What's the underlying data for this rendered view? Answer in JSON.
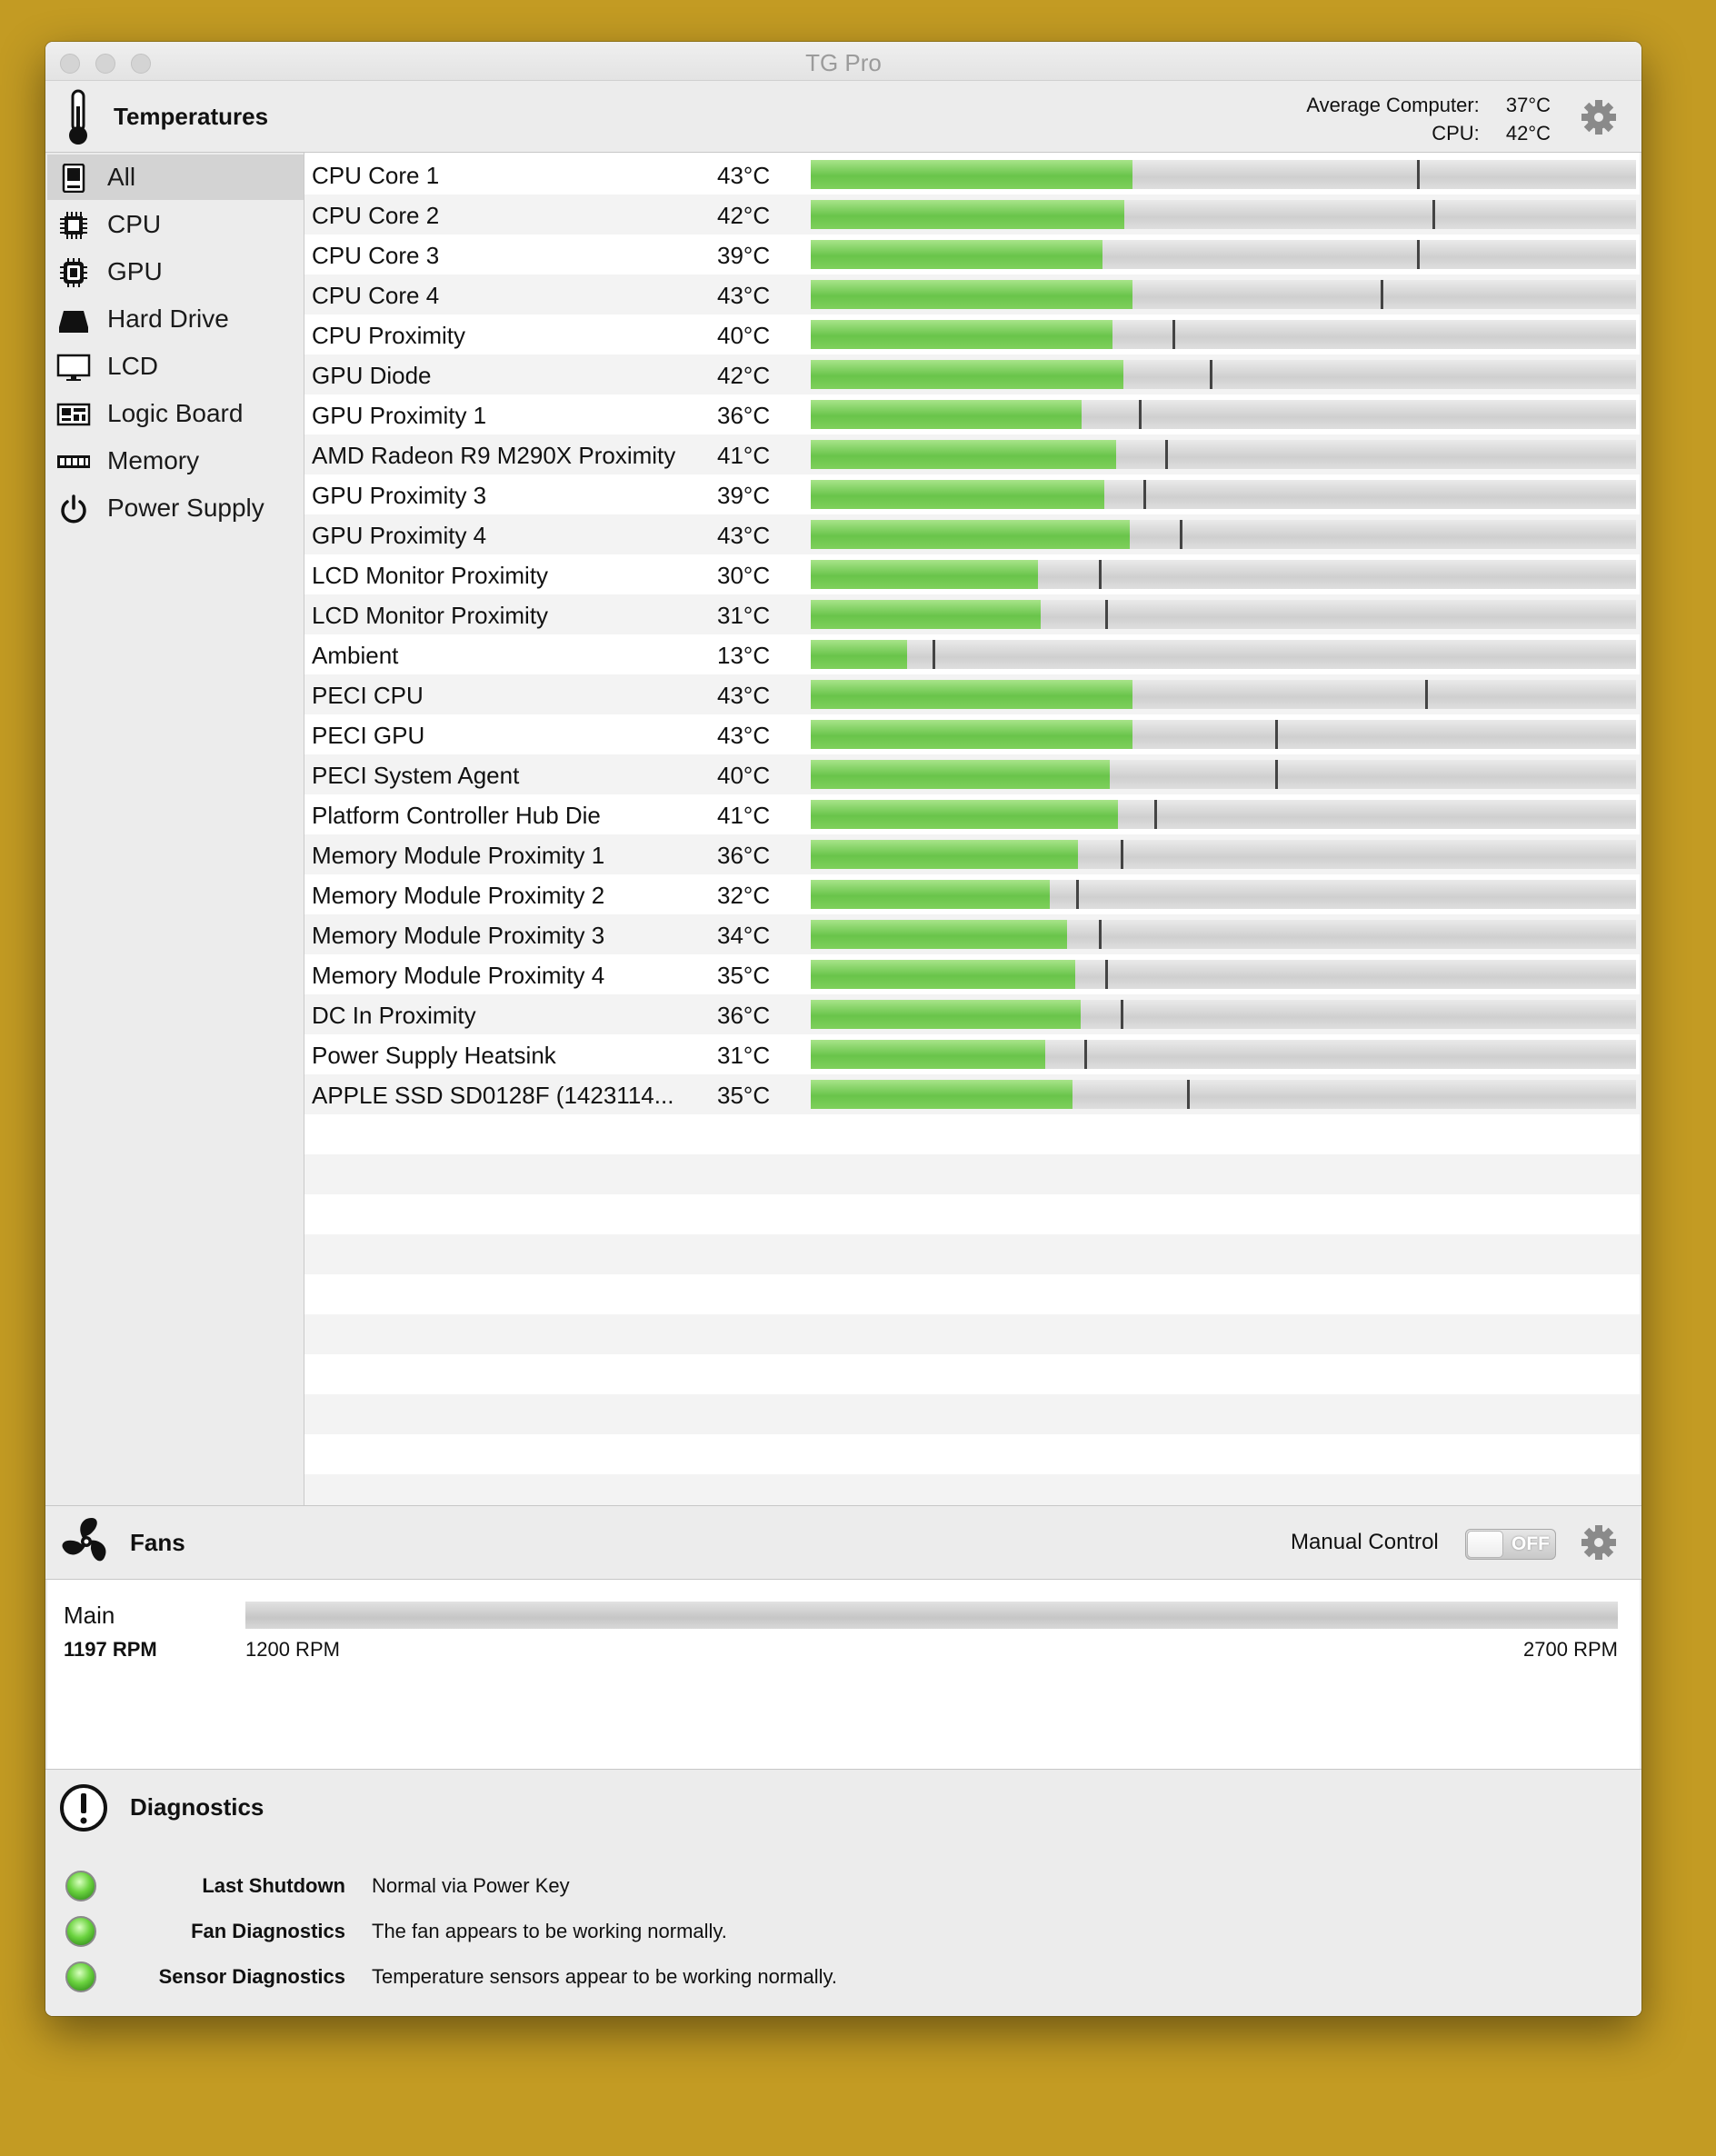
{
  "window": {
    "title": "TG Pro"
  },
  "temperatures": {
    "title": "Temperatures",
    "average_label": "Average Computer:",
    "average_value": "37°C",
    "cpu_label": "CPU:",
    "cpu_value": "42°C"
  },
  "sidebar": {
    "items": [
      {
        "label": "All",
        "icon": "computer-icon",
        "selected": true
      },
      {
        "label": "CPU",
        "icon": "cpu-chip-icon"
      },
      {
        "label": "GPU",
        "icon": "gpu-chip-icon"
      },
      {
        "label": "Hard Drive",
        "icon": "hard-drive-icon"
      },
      {
        "label": "LCD",
        "icon": "monitor-icon"
      },
      {
        "label": "Logic Board",
        "icon": "logic-board-icon"
      },
      {
        "label": "Memory",
        "icon": "memory-icon"
      },
      {
        "label": "Power Supply",
        "icon": "power-icon"
      }
    ]
  },
  "sensors": [
    {
      "name": "CPU Core 1",
      "temp": "43°C",
      "level": 0.39,
      "max": 0.735
    },
    {
      "name": "CPU Core 2",
      "temp": "42°C",
      "level": 0.38,
      "max": 0.753
    },
    {
      "name": "CPU Core 3",
      "temp": "39°C",
      "level": 0.353,
      "max": 0.735
    },
    {
      "name": "CPU Core 4",
      "temp": "43°C",
      "level": 0.39,
      "max": 0.69
    },
    {
      "name": "CPU Proximity",
      "temp": "40°C",
      "level": 0.366,
      "max": 0.438
    },
    {
      "name": "GPU Diode",
      "temp": "42°C",
      "level": 0.379,
      "max": 0.484
    },
    {
      "name": "GPU Proximity 1",
      "temp": "36°C",
      "level": 0.328,
      "max": 0.398
    },
    {
      "name": "AMD Radeon R9 M290X Proximity",
      "temp": "41°C",
      "level": 0.37,
      "max": 0.429
    },
    {
      "name": "GPU Proximity 3",
      "temp": "39°C",
      "level": 0.356,
      "max": 0.403
    },
    {
      "name": "GPU Proximity 4",
      "temp": "43°C",
      "level": 0.387,
      "max": 0.447
    },
    {
      "name": "LCD Monitor Proximity",
      "temp": "30°C",
      "level": 0.275,
      "max": 0.349
    },
    {
      "name": "LCD Monitor Proximity",
      "temp": "31°C",
      "level": 0.279,
      "max": 0.357
    },
    {
      "name": "Ambient",
      "temp": "13°C",
      "level": 0.117,
      "max": 0.148
    },
    {
      "name": "PECI CPU",
      "temp": "43°C",
      "level": 0.39,
      "max": 0.744
    },
    {
      "name": "PECI GPU",
      "temp": "43°C",
      "level": 0.39,
      "max": 0.563
    },
    {
      "name": "PECI System Agent",
      "temp": "40°C",
      "level": 0.362,
      "max": 0.563
    },
    {
      "name": "Platform Controller Hub Die",
      "temp": "41°C",
      "level": 0.372,
      "max": 0.416
    },
    {
      "name": "Memory Module Proximity 1",
      "temp": "36°C",
      "level": 0.324,
      "max": 0.376
    },
    {
      "name": "Memory Module Proximity 2",
      "temp": "32°C",
      "level": 0.29,
      "max": 0.322
    },
    {
      "name": "Memory Module Proximity 3",
      "temp": "34°C",
      "level": 0.311,
      "max": 0.349
    },
    {
      "name": "Memory Module Proximity 4",
      "temp": "35°C",
      "level": 0.32,
      "max": 0.357
    },
    {
      "name": "DC In Proximity",
      "temp": "36°C",
      "level": 0.327,
      "max": 0.376
    },
    {
      "name": "Power Supply Heatsink",
      "temp": "31°C",
      "level": 0.284,
      "max": 0.331
    },
    {
      "name": "APPLE SSD SD0128F (1423114...",
      "temp": "35°C",
      "level": 0.317,
      "max": 0.456
    }
  ],
  "fans": {
    "title": "Fans",
    "manual_control_label": "Manual Control",
    "toggle_state": "OFF",
    "items": [
      {
        "name": "Main",
        "rpm": "1197 RPM",
        "min_label": "1200 RPM",
        "max_label": "2700 RPM",
        "level": 0
      }
    ]
  },
  "diagnostics": {
    "title": "Diagnostics",
    "items": [
      {
        "label": "Last Shutdown",
        "value": "Normal via Power Key",
        "status": "green"
      },
      {
        "label": "Fan Diagnostics",
        "value": "The fan appears to be working normally.",
        "status": "green"
      },
      {
        "label": "Sensor Diagnostics",
        "value": "Temperature sensors appear to be working normally.",
        "status": "green"
      }
    ]
  },
  "colors": {
    "background": "#c39b23",
    "bar_fill": "#69c44a",
    "status_ok": "#6bd33f"
  }
}
